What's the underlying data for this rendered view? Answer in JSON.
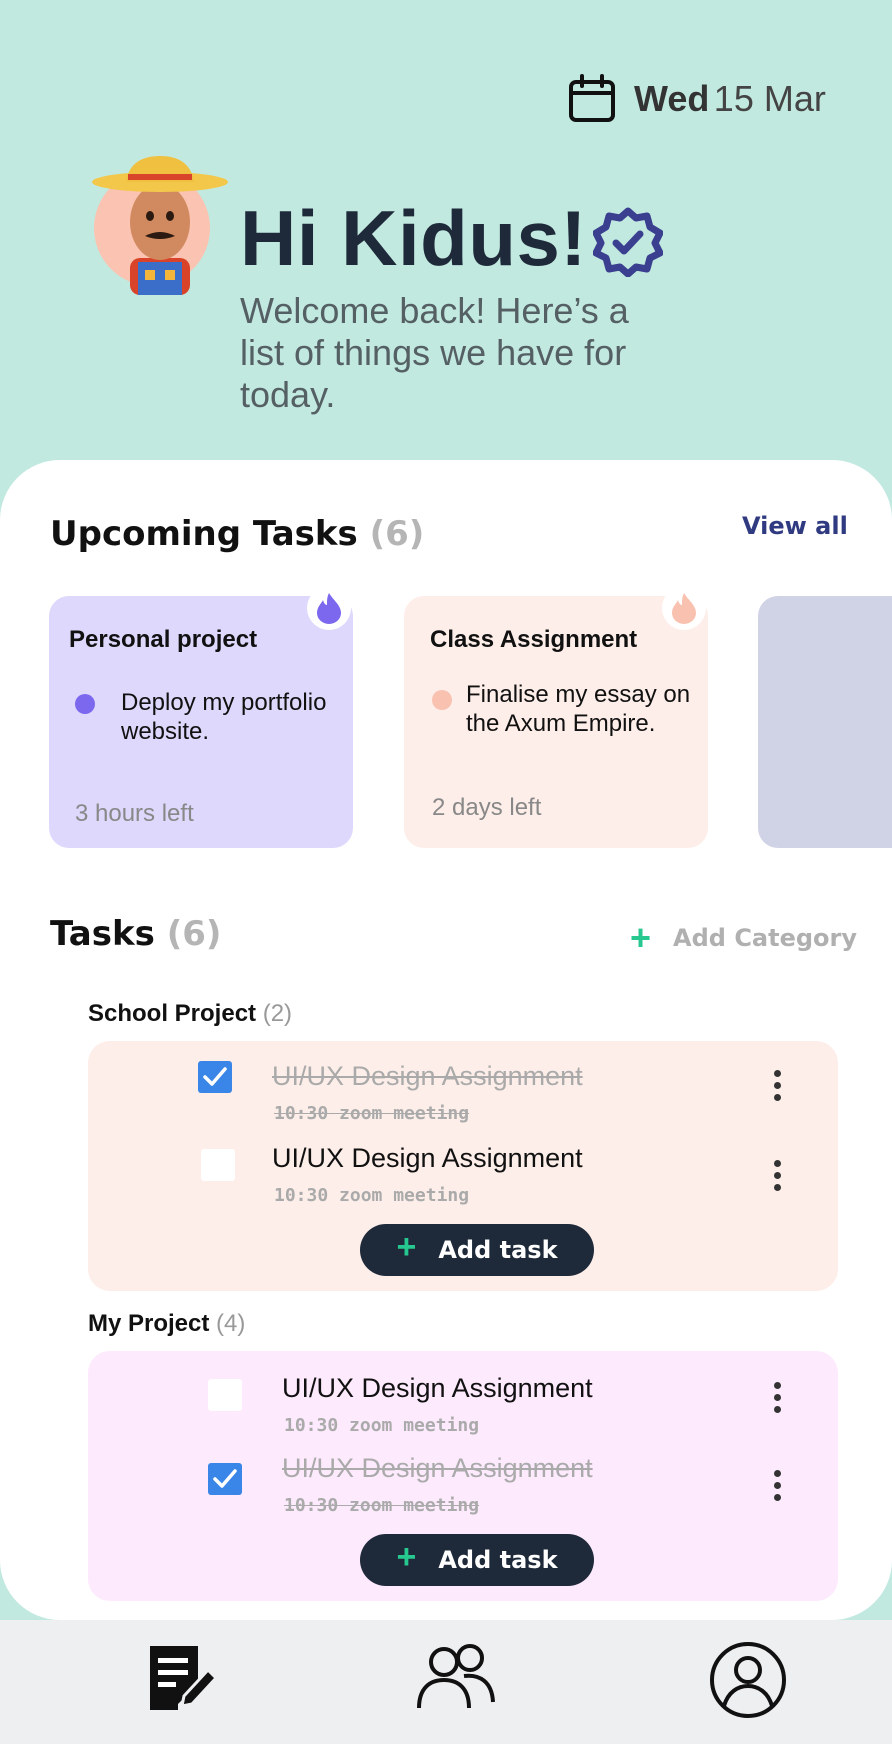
{
  "header": {
    "day": "Wed",
    "date": "15 Mar",
    "greeting": "Hi Kidus!",
    "welcome": "Welcome back! Here’s a list of things we have for today."
  },
  "upcoming": {
    "title": "Upcoming Tasks",
    "count": "(6)",
    "view_all": "View all",
    "cards": [
      {
        "title": "Personal project",
        "desc": "Deploy my portfolio website.",
        "time_left": "3 hours left",
        "color": "#ddd8fc",
        "dot": "#7b68ee",
        "flame": "#7b68ee"
      },
      {
        "title": "Class Assignment",
        "desc": "Finalise my essay on the Axum Empire.",
        "time_left": "2 days left",
        "color": "#fdeee9",
        "dot": "#f9c2b0",
        "flame": "#f9c2b0"
      },
      {
        "color": "#d0d2e6"
      }
    ]
  },
  "tasks": {
    "title": "Tasks",
    "count": "(6)",
    "add_category": "Add Category",
    "groups": [
      {
        "name": "School Project",
        "count": "(2)",
        "color": "#fdeee9",
        "items": [
          {
            "title": "UI/UX Design Assignment",
            "time": "10:30",
            "note": "zoom meeting",
            "done": true
          },
          {
            "title": "UI/UX Design Assignment",
            "time": "10:30",
            "note": "zoom meeting",
            "done": false
          }
        ],
        "add_label": "Add task"
      },
      {
        "name": "My Project",
        "count": "(4)",
        "color": "#fdeafd",
        "items": [
          {
            "title": "UI/UX Design Assignment",
            "time": "10:30",
            "note": "zoom meeting",
            "done": false
          },
          {
            "title": "UI/UX Design Assignment",
            "time": "10:30",
            "note": "zoom meeting",
            "done": true
          }
        ],
        "add_label": "Add task"
      }
    ]
  },
  "nav": {
    "items": [
      {
        "icon": "notes-icon"
      },
      {
        "icon": "people-icon"
      },
      {
        "icon": "profile-icon"
      }
    ]
  },
  "colors": {
    "header_bg": "#c2e9e0",
    "accent_green": "#27c88f",
    "dark": "#1e2a3a",
    "check_blue": "#3a86e8",
    "verified_badge": "#3a3f8f"
  }
}
